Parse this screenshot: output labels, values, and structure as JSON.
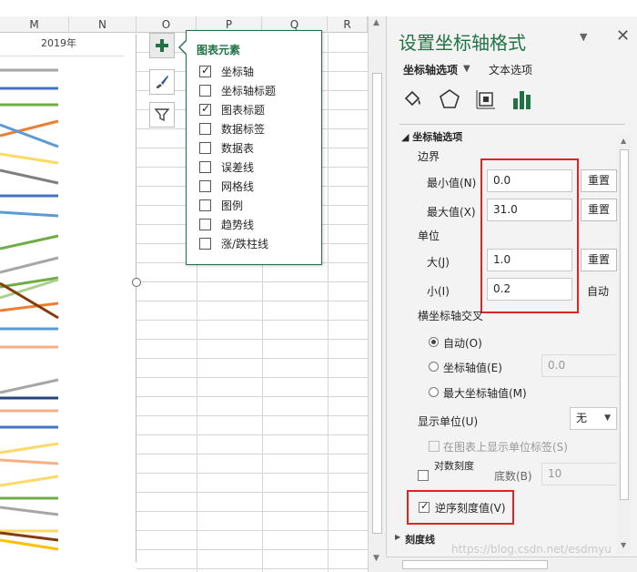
{
  "sheet": {
    "columns": [
      "M",
      "N",
      "O",
      "P",
      "Q",
      "R"
    ],
    "chart_year": "2019年",
    "line_colors": [
      "#a6a6a6",
      "#4472c4",
      "#70ad47",
      "#ed7d31",
      "#5b9bd5",
      "#ffd966",
      "#7f7f7f",
      "#264478",
      "#a9d18e",
      "#c5c5c5",
      "#843c0c",
      "#f4b183",
      "#ffc000"
    ]
  },
  "chart_tools": {
    "plus_icon": "plus-icon",
    "brush_icon": "brush-icon",
    "filter_icon": "filter-icon"
  },
  "elements_popup": {
    "title": "图表元素",
    "items": [
      {
        "label": "坐标轴",
        "checked": true
      },
      {
        "label": "坐标轴标题",
        "checked": false
      },
      {
        "label": "图表标题",
        "checked": true
      },
      {
        "label": "数据标签",
        "checked": false
      },
      {
        "label": "数据表",
        "checked": false
      },
      {
        "label": "误差线",
        "checked": false
      },
      {
        "label": "网格线",
        "checked": false
      },
      {
        "label": "图例",
        "checked": false
      },
      {
        "label": "趋势线",
        "checked": false
      },
      {
        "label": "涨/跌柱线",
        "checked": false
      }
    ]
  },
  "pane": {
    "title": "设置坐标轴格式",
    "dropdown_icon": "▼",
    "close_icon": "✕",
    "tab_axis_options": "坐标轴选项",
    "tab_text_options": "文本选项",
    "section_axis": "坐标轴选项",
    "bounds_label": "边界",
    "min_label": "最小值(N)",
    "min_value": "0.0",
    "max_label": "最大值(X)",
    "max_value": "31.0",
    "reset_label": "重置",
    "units_label": "单位",
    "major_label": "大(J)",
    "major_value": "1.0",
    "minor_label": "小(I)",
    "minor_value": "0.2",
    "auto_label": "自动",
    "cross_label": "横坐标轴交叉",
    "cross_auto": "自动(O)",
    "cross_value_label": "坐标轴值(E)",
    "cross_value": "0.0",
    "cross_max": "最大坐标轴值(M)",
    "display_units_label": "显示单位(U)",
    "display_units_value": "无",
    "show_units_label": "在图表上显示单位标签(S)",
    "log_scale_label": "对数刻度",
    "base_label": "底数(B)",
    "base_value": "10",
    "reverse_label": "逆序刻度值(V)",
    "tick_marks_label": "刻度线",
    "watermark": "https://blog.csdn.net/esdmyu"
  }
}
